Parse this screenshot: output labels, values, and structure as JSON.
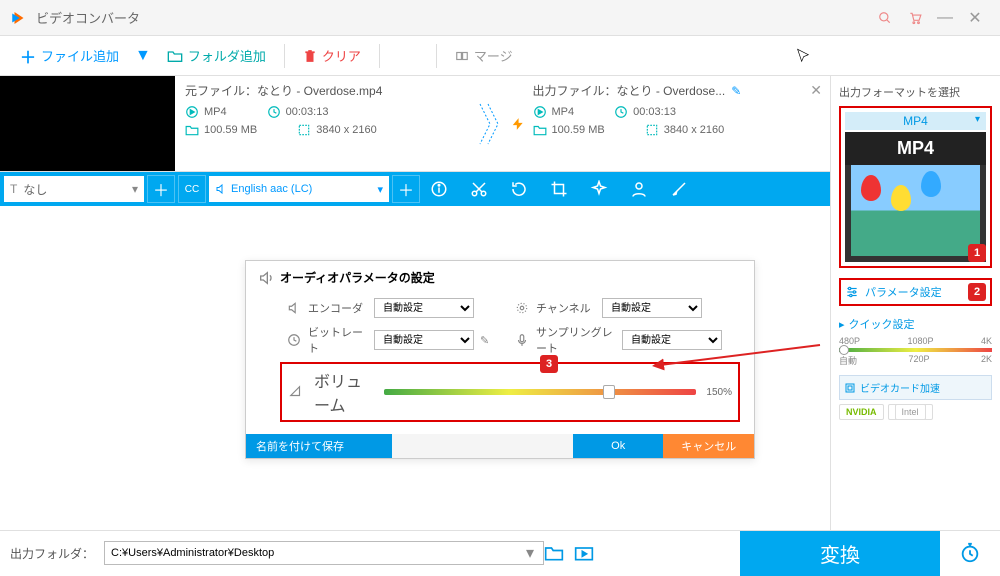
{
  "window": {
    "title": "ビデオコンバータ"
  },
  "toolbar": {
    "add_file": "ファイル追加",
    "add_folder": "フォルダ追加",
    "clear": "クリア",
    "merge": "マージ"
  },
  "file": {
    "src_label": "元ファイル：なとり - Overdose.mp4",
    "out_label": "出力ファイル：なとり - Overdose...",
    "src": {
      "format": "MP4",
      "duration": "00:03:13",
      "size": "100.59 MB",
      "resolution": "3840 x 2160"
    },
    "out": {
      "format": "MP4",
      "duration": "00:03:13",
      "size": "100.59 MB",
      "resolution": "3840 x 2160"
    }
  },
  "ctrl": {
    "subtitle": "なし",
    "audio": "English aac (LC)"
  },
  "panel": {
    "title": "オーディオパラメータの設定",
    "encoder_lbl": "エンコーダ",
    "encoder_val": "自動設定",
    "bitrate_lbl": "ビットレート",
    "bitrate_val": "自動設定",
    "channel_lbl": "チャンネル",
    "channel_val": "自動設定",
    "sample_lbl": "サンプリングレート",
    "sample_val": "自動設定",
    "volume_lbl": "ボリューム",
    "volume_val": "150%",
    "save": "名前を付けて保存",
    "ok": "Ok",
    "cancel": "キャンセル"
  },
  "right": {
    "select_fmt": "出力フォーマットを選択",
    "fmt": "MP4",
    "param_settings": "パラメータ設定",
    "quick_label": "クイック設定",
    "scale": [
      "480P",
      "1080P",
      "4K",
      "自動",
      "720P",
      "2K"
    ],
    "gpu": "ビデオカード加速",
    "nvidia": "NVIDIA",
    "intel": "Intel"
  },
  "footer": {
    "out_label": "出力フォルダ：",
    "path": "C:¥Users¥Administrator¥Desktop",
    "convert": "変換"
  },
  "badges": {
    "b1": "1",
    "b2": "2",
    "b3": "3"
  }
}
